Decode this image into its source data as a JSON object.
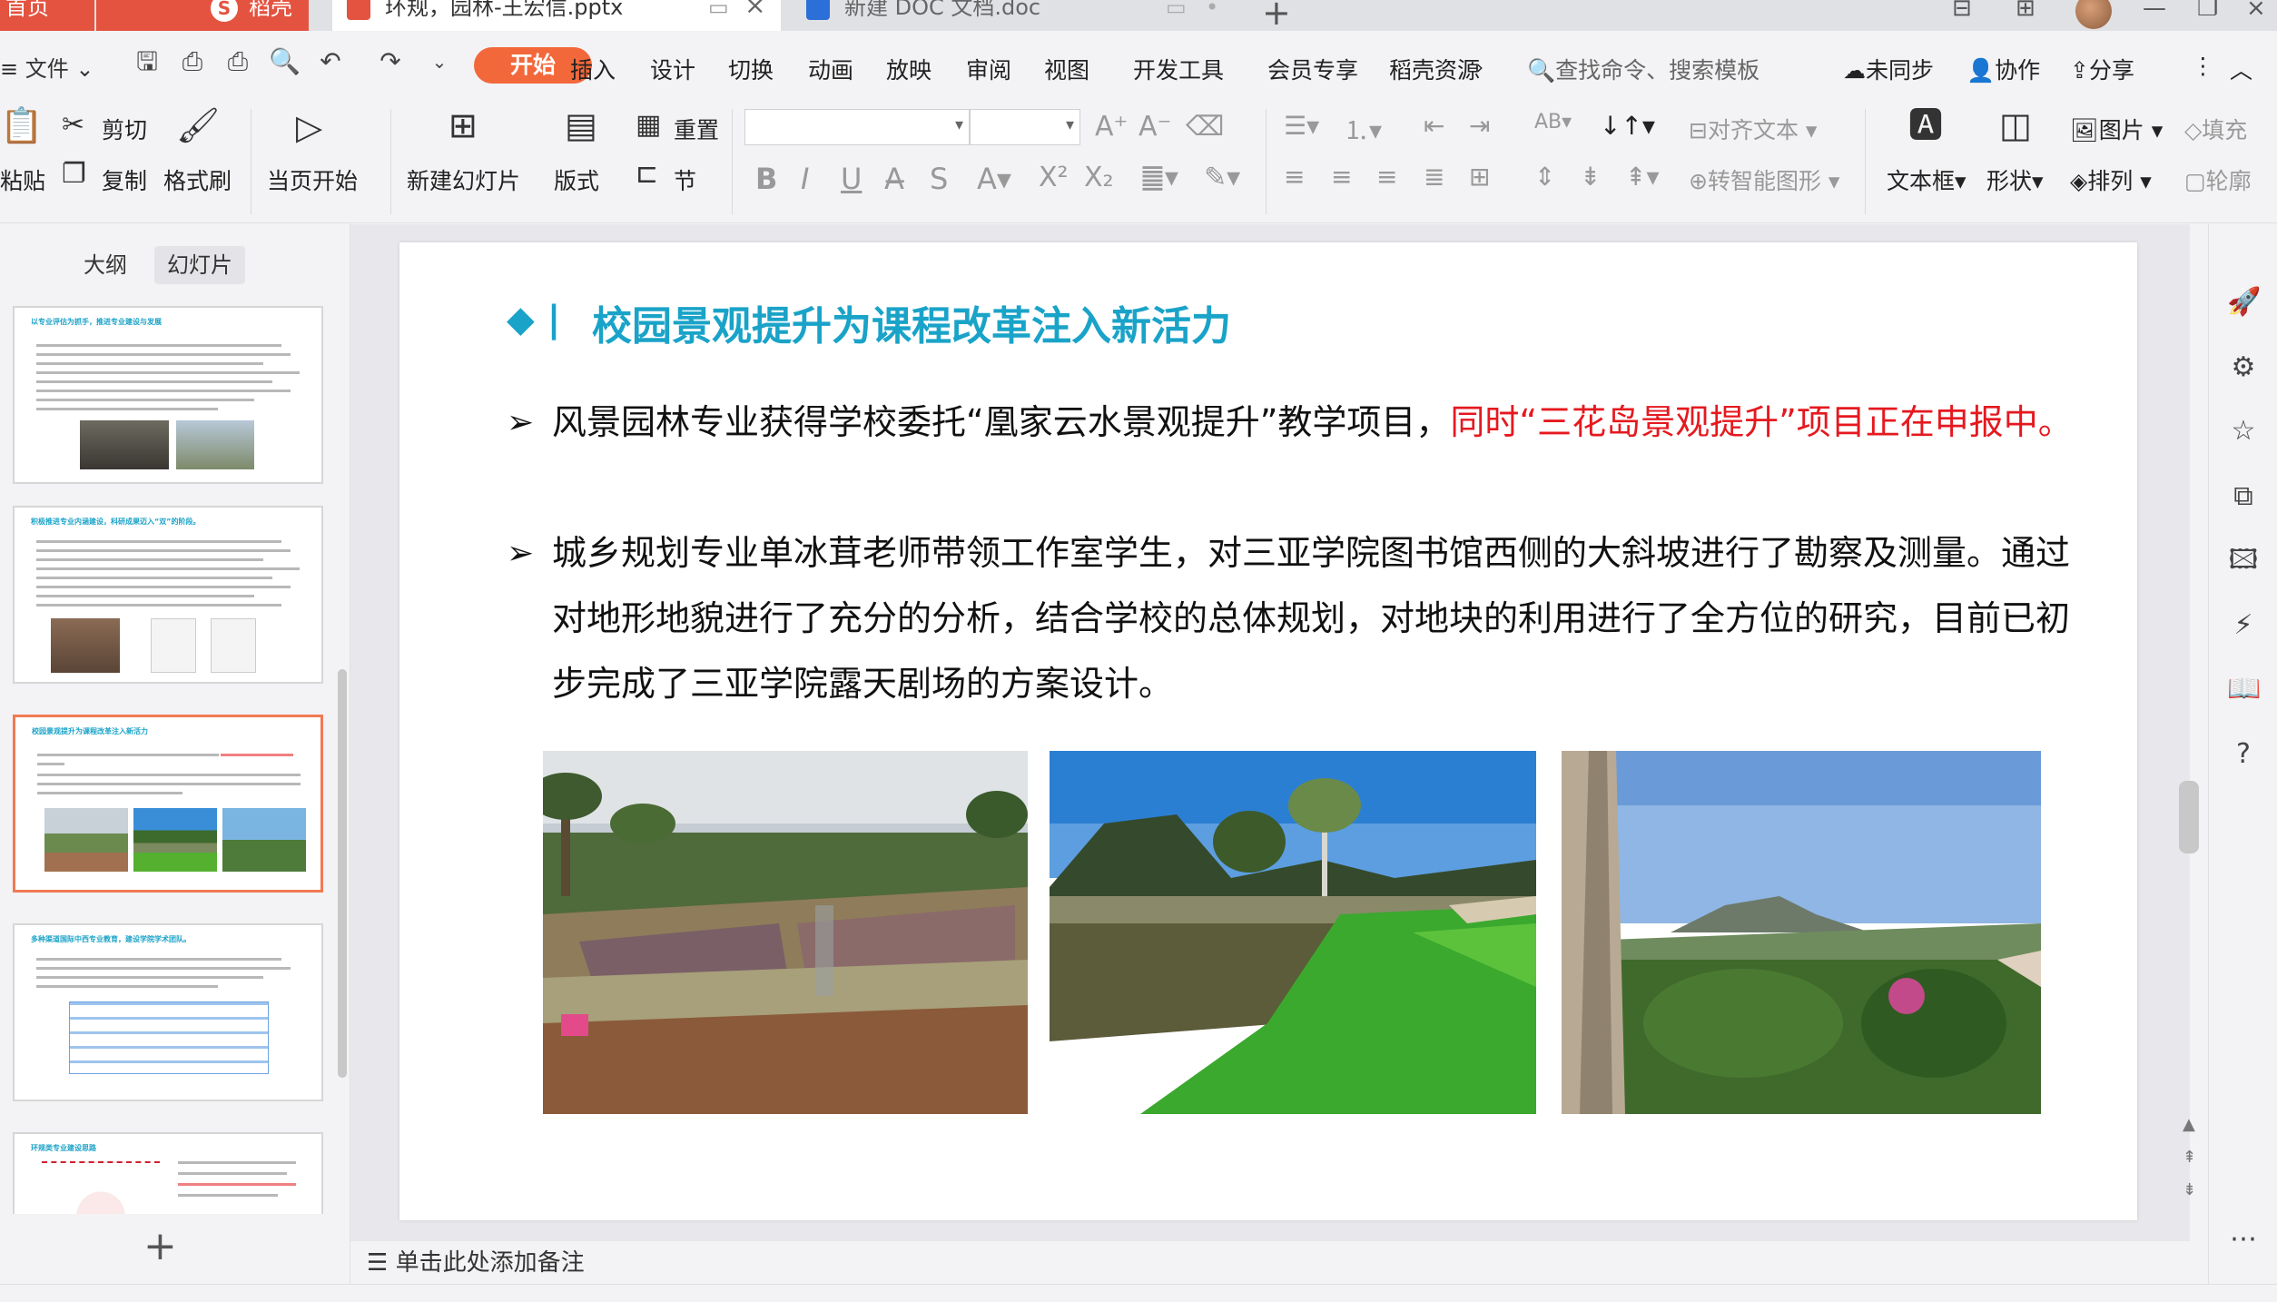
{
  "tabs": {
    "home": "首页",
    "daoke": "稻壳",
    "pptx": "环规，园林-王宏信.pptx",
    "doc": "新建 DOC 文档.doc"
  },
  "menubar": {
    "file": "文件",
    "start": "开始",
    "items": [
      "插入",
      "设计",
      "切换",
      "动画",
      "放映",
      "审阅",
      "视图",
      "开发工具",
      "会员专享",
      "稻壳资源"
    ],
    "search": "查找命令、搜索模板",
    "unsynced": "未同步",
    "collab": "协作",
    "share": "分享"
  },
  "ribbon": {
    "paste": "粘贴",
    "cut": "剪切",
    "copy": "复制",
    "format_painter": "格式刷",
    "play_current": "当页开始",
    "new_slide": "新建幻灯片",
    "layout": "版式",
    "reset": "重置",
    "section": "节",
    "align_text": "对齐文本",
    "smart_shape": "转智能图形",
    "textbox": "文本框",
    "shape": "形状",
    "picture": "图片",
    "arrange": "排列",
    "fill": "填充",
    "outline": "轮廓"
  },
  "leftpanel": {
    "outline_tab": "大纲",
    "slides_tab": "幻灯片",
    "thumb_titles": [
      "以专业评估为抓手，推进专业建设与发展",
      "积极推进专业内涵建设，科研成果迈入“双”的阶段。",
      "校园景观提升为课程改革注入新活力",
      "多种渠道国际中西专业教育，建设学院学术团队。",
      "环规类专业建设思路"
    ]
  },
  "slide": {
    "title": "校园景观提升为课程改革注入新活力",
    "p1_black": "风景园林专业获得学校委托“凰家云水景观提升”教学项目，",
    "p1_red": "同时“三花岛景观提升”项目正在申报中。",
    "p2": "城乡规划专业单冰茸老师带领工作室学生，对三亚学院图书馆西侧的大斜坡进行了勘察及测量。通过对地形地貌进行了充分的分析，结合学校的总体规划，对地块的利用进行了全方位的研究，目前已初步完成了三亚学院露天剧场的方案设计。"
  },
  "notes": "单击此处添加备注",
  "colors": {
    "accent": "#f2683b",
    "title": "#1aa3c8",
    "highlight_red": "#e5191f"
  }
}
